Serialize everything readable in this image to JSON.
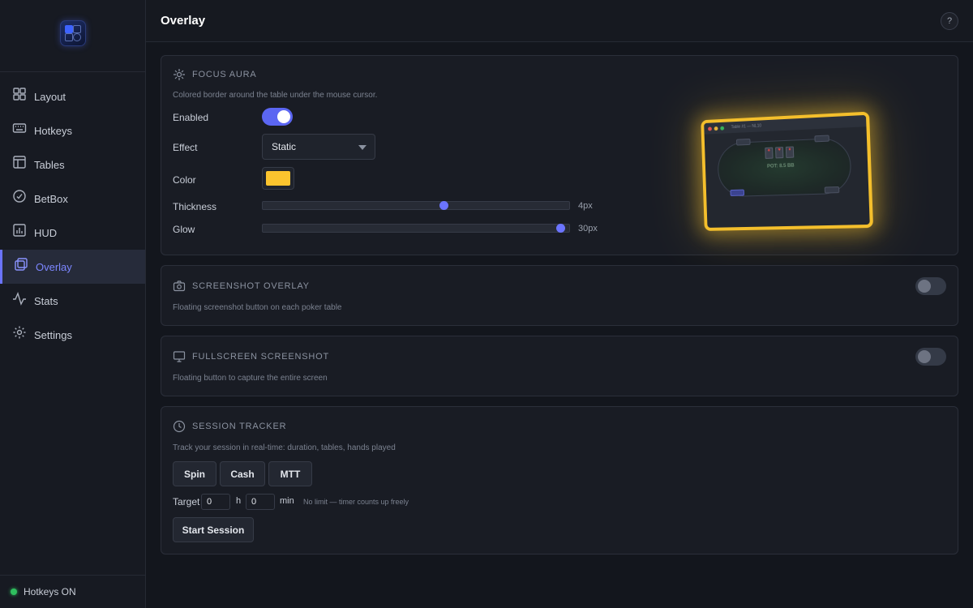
{
  "sidebar": {
    "items": [
      {
        "label": "Layout",
        "icon": "layout-grid-icon"
      },
      {
        "label": "Hotkeys",
        "icon": "keyboard-icon"
      },
      {
        "label": "Tables",
        "icon": "table-icon"
      },
      {
        "label": "BetBox",
        "icon": "coin-icon"
      },
      {
        "label": "HUD",
        "icon": "bar-chart-icon"
      },
      {
        "label": "Overlay",
        "icon": "layers-icon",
        "active": true
      },
      {
        "label": "Stats",
        "icon": "activity-icon"
      },
      {
        "label": "Settings",
        "icon": "gear-icon"
      }
    ],
    "footer": {
      "status": "Hotkeys ON",
      "status_color": "#2fbf5e"
    }
  },
  "header": {
    "title": "Overlay",
    "help": "?"
  },
  "focus_aura": {
    "title": "FOCUS AURA",
    "description": "Colored border around the table under the mouse cursor.",
    "enabled_label": "Enabled",
    "enabled": true,
    "effect_label": "Effect",
    "effect_value": "Static",
    "color_label": "Color",
    "color_value": "#fbc42e",
    "thickness_label": "Thickness",
    "thickness_value": "4px",
    "thickness_fraction": 0.59,
    "glow_label": "Glow",
    "glow_value": "30px",
    "glow_fraction": 0.98,
    "preview": {
      "window_title": "Table #1 — NL10",
      "pot": "POT: 8.5 BB"
    }
  },
  "screenshot_overlay": {
    "title": "SCREENSHOT OVERLAY",
    "description": "Floating screenshot button on each poker table",
    "enabled": false
  },
  "fullscreen_screenshot": {
    "title": "FULLSCREEN SCREENSHOT",
    "description": "Floating button to capture the entire screen",
    "enabled": false
  },
  "session_tracker": {
    "title": "SESSION TRACKER",
    "description": "Track your session in real-time: duration, tables, hands played",
    "modes": [
      "Spin",
      "Cash",
      "MTT"
    ],
    "target_label": "Target",
    "hours_value": "0",
    "hours_unit": "h",
    "minutes_value": "0",
    "minutes_unit": "min",
    "hint": "No limit — timer counts up freely",
    "start_label": "Start Session"
  },
  "accent_color": "#6b74ff"
}
